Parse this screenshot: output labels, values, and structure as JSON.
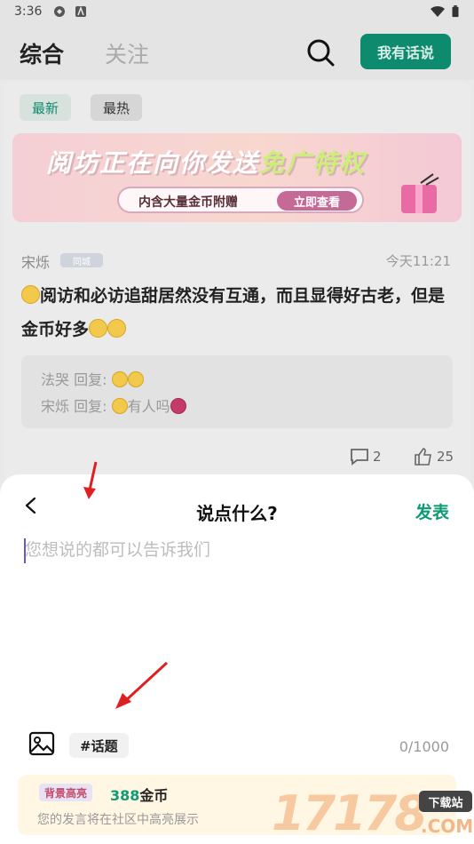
{
  "status_bar": {
    "time": "3:36"
  },
  "header": {
    "tabs": [
      {
        "label": "综合",
        "active": true
      },
      {
        "label": "关注",
        "active": false
      }
    ],
    "talk_button": "我有话说",
    "accent_color": "#0e8a6f"
  },
  "feed": {
    "filters": [
      {
        "label": "最新",
        "active": true
      },
      {
        "label": "最热",
        "active": false
      }
    ],
    "banner": {
      "title_a": "阅坊正在向你发送",
      "title_b": "免广特权",
      "pill_text": "内含大量金币附赠",
      "pill_button": "立即查看"
    },
    "post": {
      "author": "宋烁",
      "badge": "同城",
      "time": "今天11:21",
      "body_a": "阅访和必访追甜居然没有互通，而且显得好古老，但是金币好多",
      "replies": [
        {
          "name": "法哭",
          "sep": " 回复: "
        },
        {
          "name": "宋烁",
          "sep": " 回复: ",
          "text": "有人吗"
        }
      ],
      "comment_count": "2",
      "like_count": "25"
    }
  },
  "sheet": {
    "title": "说点什么?",
    "publish": "发表",
    "placeholder": "您想说的都可以告诉我们",
    "topic_button": "#话题",
    "counter": "0/1000",
    "highlight": {
      "badge": "背景高亮",
      "price_num": "388",
      "price_unit": "金币",
      "desc": "您的发言将在社区中高亮展示"
    }
  },
  "watermark": {
    "digits": "17178",
    "tag": "下载站",
    "suffix": ".COM"
  }
}
